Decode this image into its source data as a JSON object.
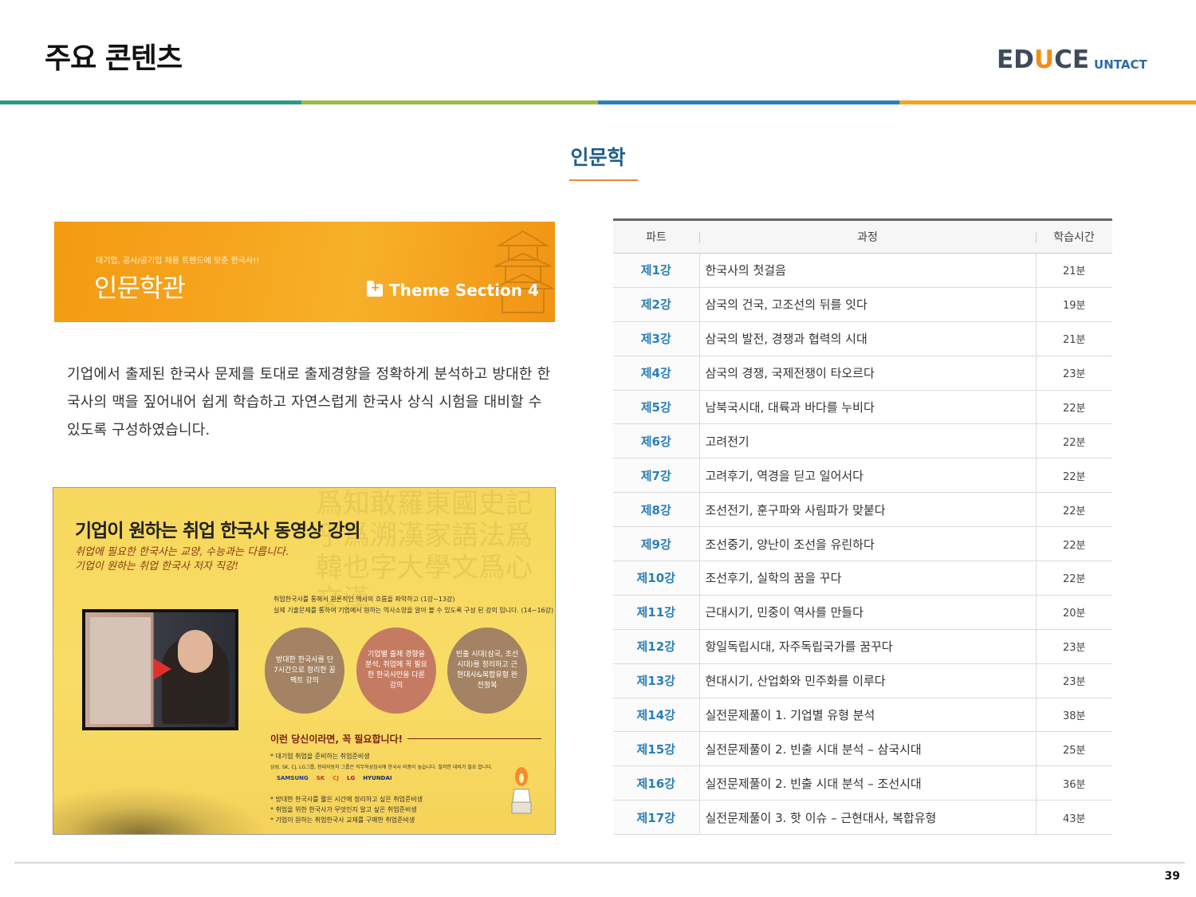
{
  "header": {
    "title": "주요 콘텐츠",
    "logo_main_a": "ED",
    "logo_main_u": "U",
    "logo_main_b": "CE",
    "logo_sub": "UNTACT"
  },
  "section": {
    "title": "인문학"
  },
  "banner": {
    "subtitle": "대기업, 공사/공기업 채용 트렌드에 맞춘 한국사!!",
    "title": "인문학관",
    "theme": "Theme Section 4"
  },
  "description": "기업에서 출제된 한국사 문제를 토대로 출제경향을 정확하게 분석하고 방대한 한국사의 맥을 짚어내어 쉽게 학습하고 자연스럽게 한국사 상식 시험을 대비할 수 있도록 구성하였습니다.",
  "poster": {
    "title": "기업이 원하는 취업 한국사 동영상 강의",
    "subtitle1": "취업에 필요한 한국사는 교양, 수능과는 다릅니다.",
    "subtitle2": "기업이 원하는 취업 한국사 저자 직강!",
    "note1": "취업한국사를 통해서 원론적인 역사의 흐름을 파악하고 (1강~13강)",
    "note2": "실제 기출문제를 통하여 기업에서 원하는 역사소양을 알아 볼 수 있도록 구성 된 강의 입니다. (14~16강)",
    "circle1": "방대한 한국사를 단 7시간으로 정리한 꼼팩트 강의",
    "circle2": "기업별 출제 경향을 분석, 취업에 꼭 필요한 한국사만을 다룬 강의",
    "circle3": "빈출 시대(삼국, 조선시대)를 정리하고 근현대사&복합유형 완전정복",
    "heading2": "이런 당신이라면, 꼭 필요합니다!",
    "list1a": "* 대기업 취업을 준비하는 취업준비생",
    "list1b": "삼성, SK, CJ, LG그룹, 현대자동차 그룹은 직무적성검사에 한국사 비중이 높습니다. 철저한 대비가 필요 합니다.",
    "brands": [
      "SAMSUNG",
      "SK",
      "CJ",
      "LG",
      "HYUNDAI"
    ],
    "list2a": "* 방대한 한국사를 짧은 시간에 정리하고 싶은 취업준비생",
    "list2b": "* 취업을 위한 한국사가 무엇인지 알고 싶은 취업준비생",
    "list2c": "* 기업이 원하는 취업한국사 교재를 구매한 취업준비생"
  },
  "table": {
    "headers": {
      "part": "파트",
      "course": "과정",
      "time": "학습시간"
    },
    "rows": [
      {
        "part": "제1강",
        "course": "한국사의 첫걸음",
        "time": "21분"
      },
      {
        "part": "제2강",
        "course": "삼국의 건국, 고조선의 뒤를 잇다",
        "time": "19분"
      },
      {
        "part": "제3강",
        "course": "삼국의 발전, 경쟁과 협력의 시대",
        "time": "21분"
      },
      {
        "part": "제4강",
        "course": "삼국의 경쟁, 국제전쟁이 타오르다",
        "time": "23분"
      },
      {
        "part": "제5강",
        "course": "남북국시대, 대륙과 바다를 누비다",
        "time": "22분"
      },
      {
        "part": "제6강",
        "course": "고려전기",
        "time": "22분"
      },
      {
        "part": "제7강",
        "course": "고려후기, 역경을 딛고 일어서다",
        "time": "22분"
      },
      {
        "part": "제8강",
        "course": "조선전기, 훈구파와 사림파가 맞붙다",
        "time": "22분"
      },
      {
        "part": "제9강",
        "course": "조선중기, 양난이 조선을 유린하다",
        "time": "22분"
      },
      {
        "part": "제10강",
        "course": "조선후기, 실학의 꿈을 꾸다",
        "time": "22분"
      },
      {
        "part": "제11강",
        "course": "근대시기, 민중이 역사를 만들다",
        "time": "20분"
      },
      {
        "part": "제12강",
        "course": "항일독립시대, 자주독립국가를 꿈꾸다",
        "time": "23분"
      },
      {
        "part": "제13강",
        "course": "현대시기, 산업화와 민주화를 이루다",
        "time": "23분"
      },
      {
        "part": "제14강",
        "course": "실전문제풀이 1. 기업별 유형 분석",
        "time": "38분"
      },
      {
        "part": "제15강",
        "course": "실전문제풀이 2. 빈출 시대 분석 – 삼국시대",
        "time": "25분"
      },
      {
        "part": "제16강",
        "course": "실전문제풀이 2. 빈출 시대 분석 – 조선시대",
        "time": "36분"
      },
      {
        "part": "제17강",
        "course": "실전문제풀이 3. 핫 이슈 – 근현대사, 복합유형",
        "time": "43분"
      }
    ]
  },
  "footer": {
    "page_number": "39"
  },
  "colors": {
    "accent_teal": "#2a9a8b",
    "accent_green": "#9bbb48",
    "accent_blue": "#2c7fb8",
    "accent_orange": "#f2a320",
    "part_blue": "#2a7fb8"
  }
}
